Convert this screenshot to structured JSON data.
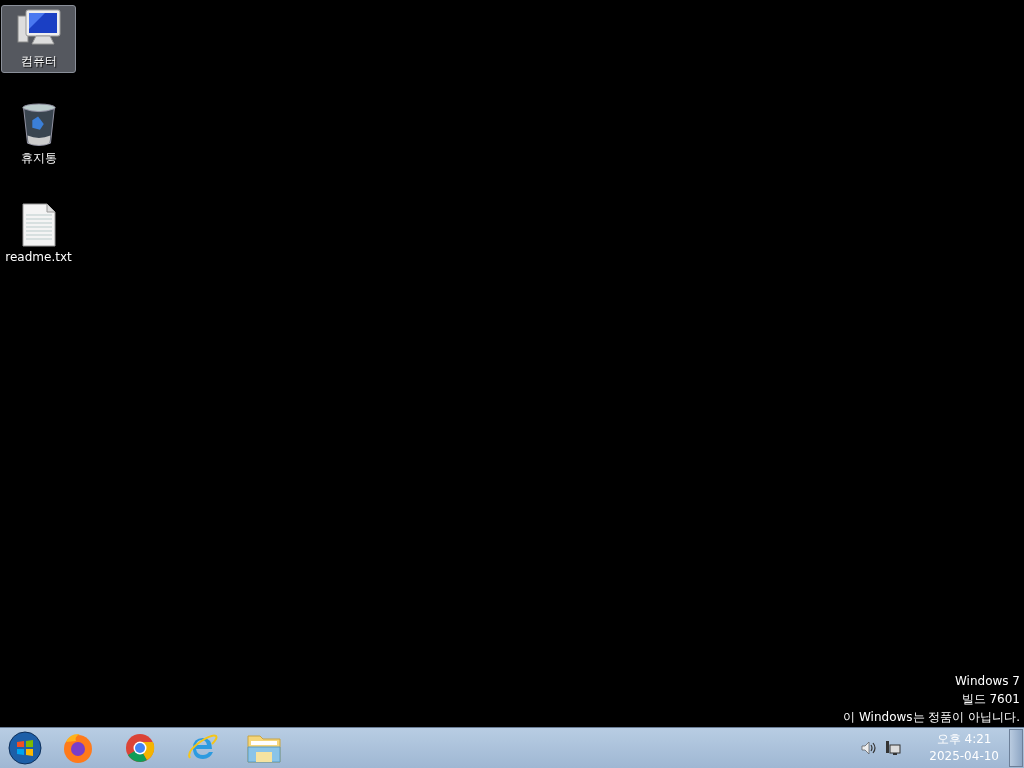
{
  "desktop_icons": [
    {
      "kind": "computer",
      "label": "컴퓨터",
      "selected": true
    },
    {
      "kind": "recycle-bin",
      "label": "휴지통",
      "selected": false
    },
    {
      "kind": "text-file",
      "label": "readme.txt",
      "selected": false
    }
  ],
  "watermark_lines": [
    "Windows 7",
    "빌드 7601",
    "이 Windows는 정품이 아닙니다."
  ],
  "taskbar": {
    "pinned": [
      {
        "kind": "firefox"
      },
      {
        "kind": "chrome"
      },
      {
        "kind": "ie"
      },
      {
        "kind": "explorer"
      }
    ],
    "tray": {
      "clock_time": "오후 4:21",
      "clock_date": "2025-04-10"
    }
  }
}
